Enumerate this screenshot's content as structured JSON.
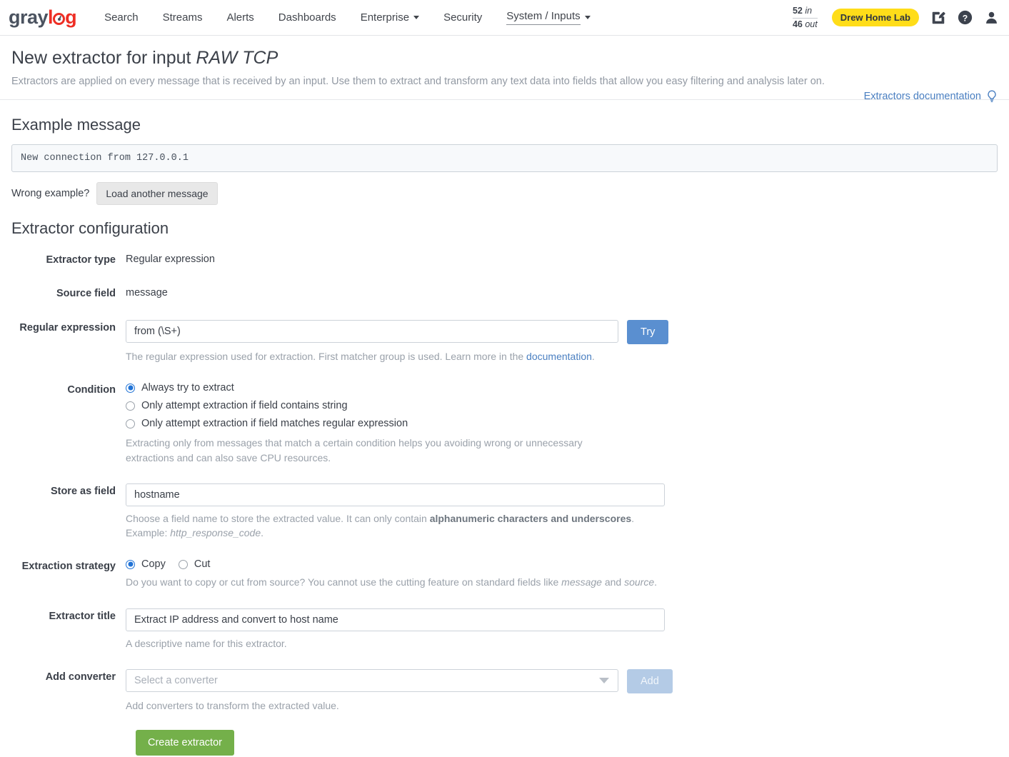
{
  "navbar": {
    "logo": {
      "part1": "gray",
      "part2": "l",
      "part3": "g",
      "icon": "logo-o-icon"
    },
    "items": [
      {
        "label": "Search",
        "has_caret": false,
        "active": false
      },
      {
        "label": "Streams",
        "has_caret": false,
        "active": false
      },
      {
        "label": "Alerts",
        "has_caret": false,
        "active": false
      },
      {
        "label": "Dashboards",
        "has_caret": false,
        "active": false
      },
      {
        "label": "Enterprise",
        "has_caret": true,
        "active": false
      },
      {
        "label": "Security",
        "has_caret": false,
        "active": false
      },
      {
        "label": "System / Inputs",
        "has_caret": true,
        "active": true
      }
    ],
    "throughput": {
      "in_value": "52",
      "in_label": "in",
      "out_value": "46",
      "out_label": "out"
    },
    "org_badge": "Drew Home Lab",
    "icons": {
      "edit": "edit-square-icon",
      "help": "help-circle-icon",
      "user": "user-avatar-icon"
    }
  },
  "header": {
    "title_prefix": "New extractor for input ",
    "title_input": "RAW TCP",
    "subtitle": "Extractors are applied on every message that is received by an input. Use them to extract and transform any text data into fields that allow you easy filtering and analysis later on.",
    "doc_link": "Extractors documentation",
    "doc_icon": "lightbulb-icon"
  },
  "example": {
    "section_title": "Example message",
    "message": "New connection from 127.0.0.1",
    "wrong_label": "Wrong example?",
    "load_button": "Load another message"
  },
  "config": {
    "section_title": "Extractor configuration",
    "extractor_type": {
      "label": "Extractor type",
      "value": "Regular expression"
    },
    "source_field": {
      "label": "Source field",
      "value": "message"
    },
    "regex": {
      "label": "Regular expression",
      "value": "from (\\S+)",
      "try_button": "Try",
      "help_before": "The regular expression used for extraction. First matcher group is used. Learn more in the ",
      "help_link": "documentation",
      "help_after": "."
    },
    "condition": {
      "label": "Condition",
      "options": [
        {
          "label": "Always try to extract",
          "checked": true
        },
        {
          "label": "Only attempt extraction if field contains string",
          "checked": false
        },
        {
          "label": "Only attempt extraction if field matches regular expression",
          "checked": false
        }
      ],
      "help": "Extracting only from messages that match a certain condition helps you avoiding wrong or unnecessary extractions and can also save CPU resources."
    },
    "store_as_field": {
      "label": "Store as field",
      "value": "hostname",
      "help_part1": "Choose a field name to store the extracted value. It can only contain ",
      "help_bold": "alphanumeric characters and underscores",
      "help_part2": ". Example: ",
      "help_em": "http_response_code",
      "help_part3": "."
    },
    "extraction_strategy": {
      "label": "Extraction strategy",
      "options": [
        {
          "label": "Copy",
          "checked": true
        },
        {
          "label": "Cut",
          "checked": false
        }
      ],
      "help_part1": "Do you want to copy or cut from source? You cannot use the cutting feature on standard fields like ",
      "help_em1": "message",
      "help_part2": " and ",
      "help_em2": "source",
      "help_part3": "."
    },
    "extractor_title": {
      "label": "Extractor title",
      "value": "Extract IP address and convert to host name",
      "help": "A descriptive name for this extractor."
    },
    "add_converter": {
      "label": "Add converter",
      "placeholder": "Select a converter",
      "add_button": "Add",
      "help": "Add converters to transform the extracted value."
    },
    "submit_button": "Create extractor"
  },
  "colors": {
    "accent_blue": "#5a8fd0",
    "brand_red": "#ee2e24",
    "badge_yellow": "#ffdd19",
    "success_green": "#74b04a",
    "radio_blue": "#2173d6",
    "link_blue": "#4a7fc1"
  }
}
